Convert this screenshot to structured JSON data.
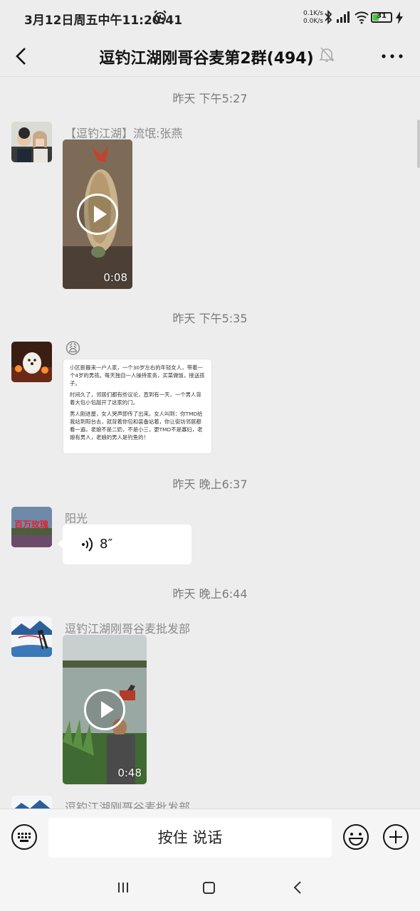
{
  "status_bar": {
    "time": "3月12日周五中午11:20:41",
    "net_up": "0.1K/s",
    "net_down": "0.0K/s",
    "battery": "31",
    "battery_level": 0.31,
    "icons": [
      "alarm-icon",
      "bluetooth-icon",
      "signal-icon",
      "wifi-icon",
      "battery-icon",
      "charging-icon"
    ]
  },
  "nav": {
    "title": "逗钓江湖刚哥谷麦第2群(494)",
    "icons": [
      "back-arrow-icon",
      "mute-bell-icon",
      "more-dots-icon"
    ]
  },
  "messages": {
    "ts1": "昨天 下午5:27",
    "m1_sender": "【逗钓江湖】流氓:张燕",
    "m1_duration": "0:08",
    "ts2": "昨天 下午5:35",
    "m2_emoji": "😩",
    "m2_image_text": [
      "小区新搬来一户人家，一个30岁左右的年轻女人，带着一个4岁的男孩。每天独自一人操持家务，买菜做饭，接送孩子。",
      "时间久了，邻居们都有些议论，直到有一天，一个男人背着大包小包敲开了这家的门。",
      "男人刚进屋，女人哭声即传了出来。女人叫到：你TMD给我站到阳台去，就背着你包和装备站着，你让街坊邻居都看一遍，老娘不是二奶，不是小三，更TMD不是寡妇，老娘有男人，老娘的男人是钓鱼的！"
    ],
    "ts3": "昨天 晚上6:37",
    "m3_sender": "阳光",
    "m3_avatar_text": "百万玫瑰",
    "m3_voice": "8″",
    "ts4": "昨天 晚上6:44",
    "m4_sender": "逗钓江湖刚哥谷麦批发部",
    "m4_duration": "0:48",
    "m5_sender": "逗钓江湖刚哥谷麦批发部"
  },
  "input": {
    "hold_to_talk": "按住 说话",
    "icons": [
      "keyboard-icon",
      "emoji-icon",
      "plus-icon"
    ]
  },
  "system_nav": {
    "icons": [
      "recent-apps-icon",
      "home-icon",
      "back-icon"
    ]
  }
}
